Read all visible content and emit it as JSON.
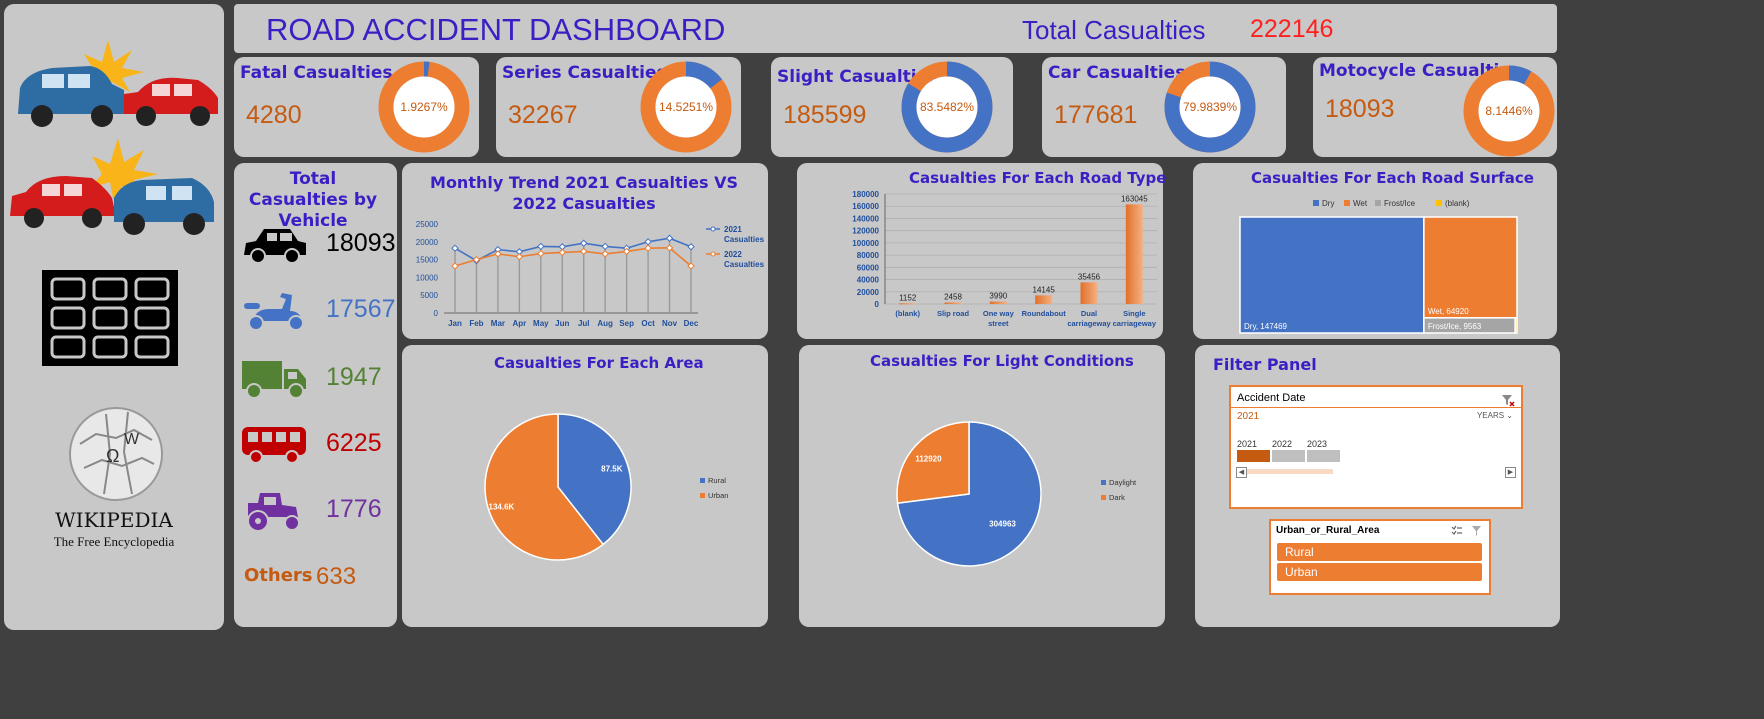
{
  "header": {
    "title": "ROAD ACCIDENT DASHBOARD",
    "total_label": "Total Casualties",
    "total_value": "222146"
  },
  "colors": {
    "blue": "#4472c4",
    "orange": "#ed7d31",
    "title_purple": "#3b1fc4",
    "value_orange": "#c55a11",
    "panel_bg": "#c8c8c8",
    "total_red": "#ff2020"
  },
  "sidebar": {
    "icons": [
      "car-crash-icon-1",
      "car-crash-icon-2",
      "grid-icon",
      "wikipedia-logo"
    ],
    "wikipedia": {
      "name": "WIKIPEDIA",
      "tagline": "The Free Encyclopedia"
    }
  },
  "kpis": [
    {
      "title": "Fatal Casualties",
      "value": "4280",
      "percent_label": "1.9267%",
      "fraction": 0.019267
    },
    {
      "title": "Series Casualties",
      "value": "32267",
      "percent_label": "14.5251%",
      "fraction": 0.145251
    },
    {
      "title": "Slight Casualties",
      "value": "185599",
      "percent_label": "83.5482%",
      "fraction": 0.835482
    },
    {
      "title": "Car Casualties",
      "value": "177681",
      "percent_label": "79.9839%",
      "fraction": 0.799839
    },
    {
      "title": "Motocycle Casualties",
      "value": "18093",
      "percent_label": "8.1446%",
      "fraction": 0.081446
    }
  ],
  "vehicles": {
    "title": "Total Casualties by Vehicle",
    "items": [
      {
        "icon": "car-icon",
        "value": "18093",
        "color": "#000000"
      },
      {
        "icon": "scooter-icon",
        "value": "17567",
        "color": "#4472c4"
      },
      {
        "icon": "truck-icon",
        "value": "1947",
        "color": "#548235"
      },
      {
        "icon": "bus-icon",
        "value": "6225",
        "color": "#c00000"
      },
      {
        "icon": "tractor-icon",
        "value": "1776",
        "color": "#7030a0"
      }
    ],
    "others_label": "Others",
    "others_value": "633"
  },
  "chart_data": [
    {
      "type": "line",
      "title": "Monthly Trend 2021 Casualties VS  2022 Casualties",
      "categories": [
        "Jan",
        "Feb",
        "Mar",
        "Apr",
        "May",
        "Jun",
        "Jul",
        "Aug",
        "Sep",
        "Oct",
        "Nov",
        "Dec"
      ],
      "yticks": [
        "25000",
        "20000",
        "15000",
        "10000",
        "5000",
        "0"
      ],
      "ylim": [
        0,
        25000
      ],
      "grid": false,
      "legend": "right",
      "series": [
        {
          "name": "2021 Casualties",
          "color": "#4472c4",
          "values": [
            18200,
            14700,
            17800,
            17200,
            18700,
            18600,
            19600,
            18700,
            18200,
            20000,
            21000,
            18600
          ]
        },
        {
          "name": "2022 Casualties",
          "color": "#ed7d31",
          "values": [
            13200,
            15000,
            16600,
            15800,
            16700,
            17000,
            17300,
            16600,
            17300,
            18200,
            18300,
            13200
          ]
        }
      ]
    },
    {
      "type": "bar",
      "title": "Casualties For Each Road Type",
      "categories": [
        "(blank)",
        "Slip road",
        "One way street",
        "Roundabout",
        "Dual carriageway",
        "Single carriageway"
      ],
      "values": [
        1152,
        2458,
        3990,
        14145,
        35456,
        163045
      ],
      "value_labels": [
        "1152",
        "2458",
        "3990",
        "14145",
        "35456",
        "163045"
      ],
      "yticks": [
        "180000",
        "160000",
        "140000",
        "120000",
        "100000",
        "80000",
        "60000",
        "40000",
        "20000",
        "0"
      ],
      "ylim": [
        0,
        180000
      ],
      "grid": true
    },
    {
      "type": "heatmap",
      "title": "Casualties For Each Road Surface",
      "legend": "top",
      "series": [
        {
          "name": "Dry",
          "value": 147469,
          "label": "Dry, 147469",
          "color": "#4472c4"
        },
        {
          "name": "Wet",
          "value": 64920,
          "label": "Wet, 64920",
          "color": "#ed7d31"
        },
        {
          "name": "Frost/Ice",
          "value": 9563,
          "label": "Frost/Ice, 9563",
          "color": "#a5a5a5"
        },
        {
          "name": "(blank)",
          "value": 194,
          "label": "",
          "color": "#ffc000"
        }
      ]
    },
    {
      "type": "pie",
      "title": "Casualties For Each Area",
      "legend": "right",
      "slices": [
        {
          "name": "Rural",
          "value": 87.5,
          "label": "87.5K",
          "color": "#4472c4"
        },
        {
          "name": "Urban",
          "value": 134.6,
          "label": "134.6K",
          "color": "#ed7d31"
        }
      ]
    },
    {
      "type": "pie",
      "title": "Casualties For Light Conditions",
      "legend": "right",
      "slices": [
        {
          "name": "Daylight",
          "value": 304963,
          "label": "304963",
          "color": "#4472c4"
        },
        {
          "name": "Dark",
          "value": 112920,
          "label": "112920",
          "color": "#ed7d31"
        }
      ]
    }
  ],
  "filter": {
    "title": "Filter Panel",
    "date_slicer": {
      "header": "Accident Date",
      "selection": "2021",
      "level": "YEARS",
      "years": [
        "2021",
        "2022",
        "2023"
      ]
    },
    "area_slicer": {
      "header": "Urban_or_Rural_Area",
      "items": [
        "Rural",
        "Urban"
      ]
    }
  }
}
